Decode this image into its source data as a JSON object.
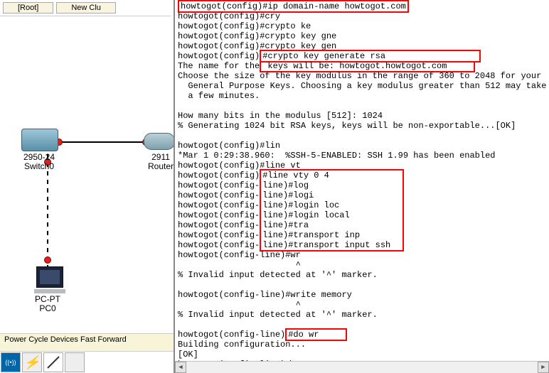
{
  "toolbar": {
    "root": "[Root]",
    "newclu": "New Clu"
  },
  "topology": {
    "switch_model": "2950-24",
    "switch_name": "Switch0",
    "router_model": "2911",
    "router_name": "Router",
    "pc_type": "PC-PT",
    "pc_name": "PC0"
  },
  "bottombar": "Power Cycle Devices  Fast Forward",
  "cli": {
    "l1a": "howtogot(config)#",
    "l1b": "ip domain-name howtogot.com",
    "l2": "howtogot(config)#cry",
    "l3": "howtogot(config)#crypto ke",
    "l4": "howtogot(config)#crypto key gne",
    "l5": "howtogot(config)#crypto key gen",
    "l6a": "howtogot(config)",
    "l6b": "#crypto key generate rsa",
    "l6b_pad": "                  ",
    "l7a": "The name for the",
    "l7b": " keys will be: howtogot.howtogot.com",
    "l7b_pad": "     ",
    "l8": "Choose the size of the key modulus in the range of 360 to 2048 for your",
    "l9": "  General Purpose Keys. Choosing a key modulus greater than 512 may take",
    "l10": "  a few minutes.",
    "l11": "",
    "l12": "How many bits in the modulus [512]: 1024",
    "l13": "% Generating 1024 bit RSA keys, keys will be non-exportable...[OK]",
    "l14": "",
    "l15": "howtogot(config)#lin",
    "l16": "*Mar 1 0:29:38.960:  %SSH-5-ENABLED: SSH 1.99 has been enabled",
    "l17": "howtogot(config)#line vt",
    "l18a": "howtogot(config)",
    "l18b": "#line vty 0 4",
    "l18b_pad": "              ",
    "l19a": "howtogot(config-",
    "l19b": "line)#log",
    "l19b_pad": "                  ",
    "l20a": "howtogot(config-",
    "l20b": "line)#logi",
    "l20b_pad": "                 ",
    "l21a": "howtogot(config-",
    "l21b": "line)#login loc",
    "l21b_pad": "            ",
    "l22a": "howtogot(config-",
    "l22b": "line)#login local",
    "l22b_pad": "          ",
    "l23a": "howtogot(config-",
    "l23b": "line)#tra",
    "l23b_pad": "                  ",
    "l24a": "howtogot(config-",
    "l24b": "line)#transport inp",
    "l24b_pad": "        ",
    "l25a": "howtogot(config-",
    "l25b": "line)#transport input ssh",
    "l25b_pad": "  ",
    "l26": "howtogot(config-line)#wr",
    "l27": "                       ^",
    "l28": "% Invalid input detected at '^' marker.",
    "l29": "",
    "l30": "howtogot(config-line)#write memory",
    "l31": "                       ^",
    "l32": "% Invalid input detected at '^' marker.",
    "l33": "",
    "l34a": "howtogot(config-line)",
    "l34b": "#do wr",
    "l34b_pad": "     ",
    "l35": "Building configuration...",
    "l36": "[OK]",
    "l37": "howtogot(config-line)#"
  }
}
